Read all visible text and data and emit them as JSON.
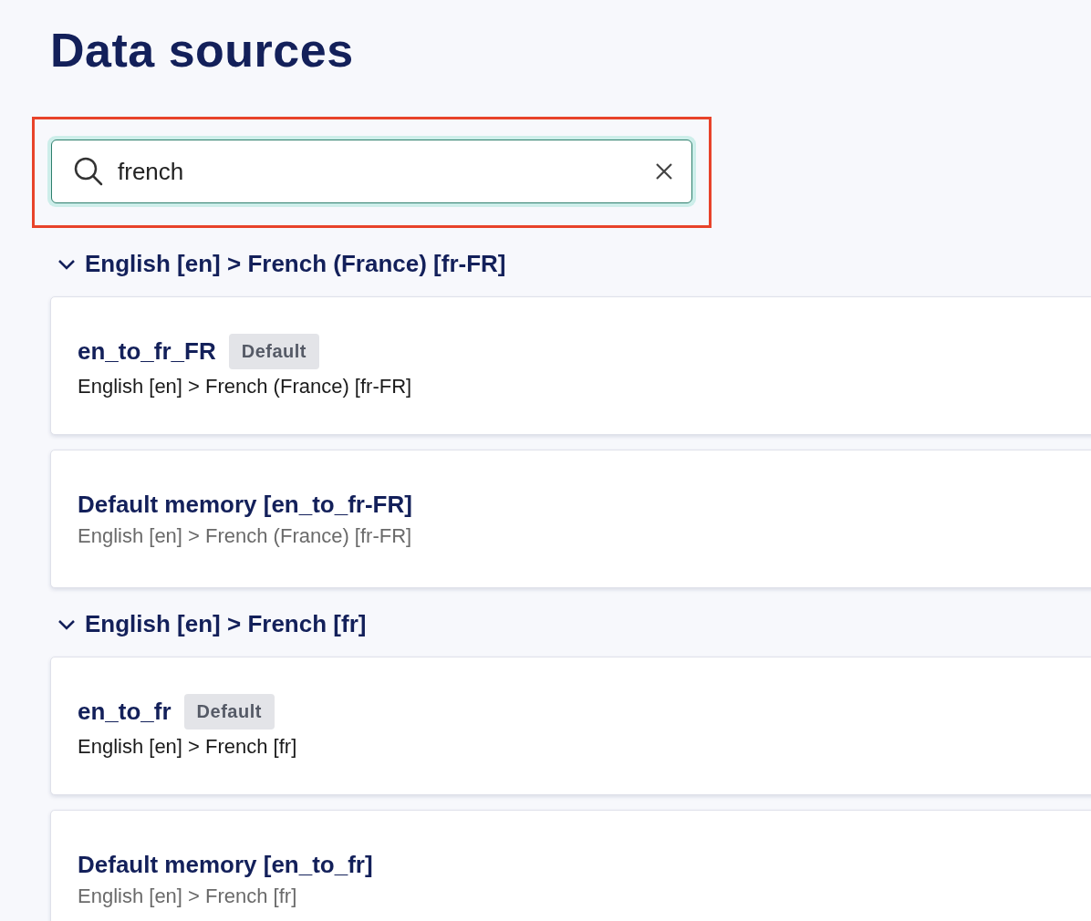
{
  "title": "Data sources",
  "search": {
    "value": "french",
    "focused": true,
    "highlighted": true
  },
  "groups": [
    {
      "title": "English [en] > French (France) [fr-FR]",
      "expanded": true,
      "items": [
        {
          "kind": "engine",
          "name": "en_to_fr_FR",
          "badge": "Default",
          "subtitle": "English [en] > French (France) [fr-FR]"
        },
        {
          "kind": "memory",
          "name": "Default memory [en_to_fr-FR]",
          "subtitle": "English [en] > French (France) [fr-FR]"
        }
      ]
    },
    {
      "title": "English [en] > French [fr]",
      "expanded": true,
      "items": [
        {
          "kind": "engine",
          "name": "en_to_fr",
          "badge": "Default",
          "subtitle": "English [en] > French [fr]"
        },
        {
          "kind": "memory",
          "name": "Default memory [en_to_fr]",
          "subtitle": "English [en] > French [fr]"
        }
      ]
    }
  ]
}
